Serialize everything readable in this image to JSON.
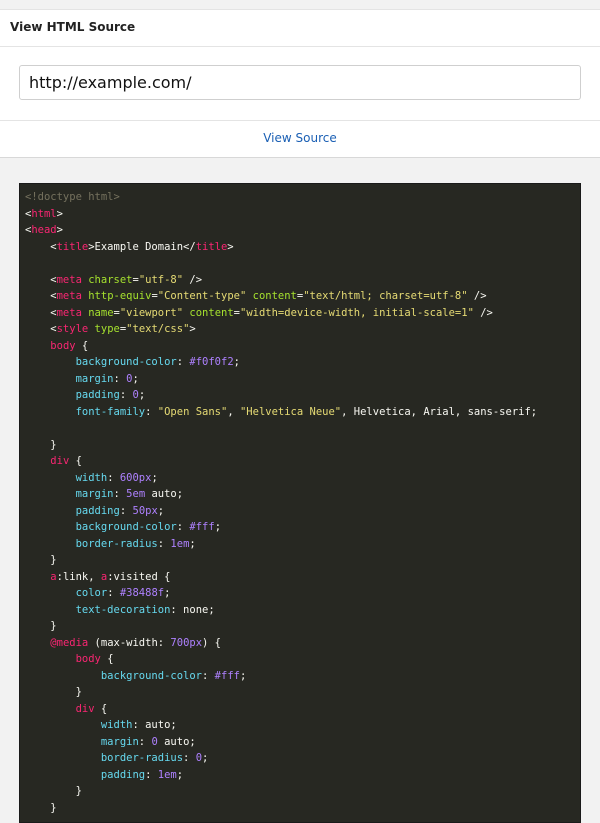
{
  "header": {
    "title": "View HTML Source"
  },
  "url_input": {
    "value": "http://example.com/"
  },
  "actions": {
    "view_source_label": "View Source"
  },
  "colors": {
    "code_bg": "#272822",
    "comment": "#75715e",
    "tag": "#f92672",
    "attr": "#a6e22e",
    "string": "#e6db74",
    "property": "#66d9ef",
    "number": "#ae81ff",
    "text": "#f8f8f2",
    "link": "#1a5fb4"
  },
  "code": [
    [
      [
        "c",
        "<!doctype html>"
      ]
    ],
    [
      [
        "p",
        "<"
      ],
      [
        "t",
        "html"
      ],
      [
        "p",
        ">"
      ]
    ],
    [
      [
        "p",
        "<"
      ],
      [
        "t",
        "head"
      ],
      [
        "p",
        ">"
      ]
    ],
    [
      [
        "p",
        "    <"
      ],
      [
        "t",
        "title"
      ],
      [
        "p",
        ">Example Domain</"
      ],
      [
        "t",
        "title"
      ],
      [
        "p",
        ">"
      ]
    ],
    [
      [
        "p",
        ""
      ]
    ],
    [
      [
        "p",
        "    <"
      ],
      [
        "t",
        "meta"
      ],
      [
        "p",
        " "
      ],
      [
        "a",
        "charset"
      ],
      [
        "p",
        "="
      ],
      [
        "s",
        "\"utf-8\""
      ],
      [
        "p",
        " />"
      ]
    ],
    [
      [
        "p",
        "    <"
      ],
      [
        "t",
        "meta"
      ],
      [
        "p",
        " "
      ],
      [
        "a",
        "http-equiv"
      ],
      [
        "p",
        "="
      ],
      [
        "s",
        "\"Content-type\""
      ],
      [
        "p",
        " "
      ],
      [
        "a",
        "content"
      ],
      [
        "p",
        "="
      ],
      [
        "s",
        "\"text/html; charset=utf-8\""
      ],
      [
        "p",
        " />"
      ]
    ],
    [
      [
        "p",
        "    <"
      ],
      [
        "t",
        "meta"
      ],
      [
        "p",
        " "
      ],
      [
        "a",
        "name"
      ],
      [
        "p",
        "="
      ],
      [
        "s",
        "\"viewport\""
      ],
      [
        "p",
        " "
      ],
      [
        "a",
        "content"
      ],
      [
        "p",
        "="
      ],
      [
        "s",
        "\"width=device-width, initial-scale=1\""
      ],
      [
        "p",
        " />"
      ]
    ],
    [
      [
        "p",
        "    <"
      ],
      [
        "t",
        "style"
      ],
      [
        "p",
        " "
      ],
      [
        "a",
        "type"
      ],
      [
        "p",
        "="
      ],
      [
        "s",
        "\"text/css\""
      ],
      [
        "p",
        ">"
      ]
    ],
    [
      [
        "p",
        "    "
      ],
      [
        "t",
        "body"
      ],
      [
        "p",
        " {"
      ]
    ],
    [
      [
        "p",
        "        "
      ],
      [
        "k",
        "background-color"
      ],
      [
        "p",
        ": "
      ],
      [
        "n",
        "#f0f0f2"
      ],
      [
        "p",
        ";"
      ]
    ],
    [
      [
        "p",
        "        "
      ],
      [
        "k",
        "margin"
      ],
      [
        "p",
        ": "
      ],
      [
        "n",
        "0"
      ],
      [
        "p",
        ";"
      ]
    ],
    [
      [
        "p",
        "        "
      ],
      [
        "k",
        "padding"
      ],
      [
        "p",
        ": "
      ],
      [
        "n",
        "0"
      ],
      [
        "p",
        ";"
      ]
    ],
    [
      [
        "p",
        "        "
      ],
      [
        "k",
        "font-family"
      ],
      [
        "p",
        ": "
      ],
      [
        "s",
        "\"Open Sans\""
      ],
      [
        "p",
        ", "
      ],
      [
        "s",
        "\"Helvetica Neue\""
      ],
      [
        "p",
        ", Helvetica, Arial, sans-serif;"
      ]
    ],
    [
      [
        "p",
        ""
      ]
    ],
    [
      [
        "p",
        "    }"
      ]
    ],
    [
      [
        "p",
        "    "
      ],
      [
        "t",
        "div"
      ],
      [
        "p",
        " {"
      ]
    ],
    [
      [
        "p",
        "        "
      ],
      [
        "k",
        "width"
      ],
      [
        "p",
        ": "
      ],
      [
        "n",
        "600px"
      ],
      [
        "p",
        ";"
      ]
    ],
    [
      [
        "p",
        "        "
      ],
      [
        "k",
        "margin"
      ],
      [
        "p",
        ": "
      ],
      [
        "n",
        "5em"
      ],
      [
        "p",
        " auto;"
      ]
    ],
    [
      [
        "p",
        "        "
      ],
      [
        "k",
        "padding"
      ],
      [
        "p",
        ": "
      ],
      [
        "n",
        "50px"
      ],
      [
        "p",
        ";"
      ]
    ],
    [
      [
        "p",
        "        "
      ],
      [
        "k",
        "background-color"
      ],
      [
        "p",
        ": "
      ],
      [
        "n",
        "#fff"
      ],
      [
        "p",
        ";"
      ]
    ],
    [
      [
        "p",
        "        "
      ],
      [
        "k",
        "border-radius"
      ],
      [
        "p",
        ": "
      ],
      [
        "n",
        "1em"
      ],
      [
        "p",
        ";"
      ]
    ],
    [
      [
        "p",
        "    }"
      ]
    ],
    [
      [
        "p",
        "    "
      ],
      [
        "t",
        "a"
      ],
      [
        "p",
        ":link, "
      ],
      [
        "t",
        "a"
      ],
      [
        "p",
        ":visited {"
      ]
    ],
    [
      [
        "p",
        "        "
      ],
      [
        "k",
        "color"
      ],
      [
        "p",
        ": "
      ],
      [
        "n",
        "#38488f"
      ],
      [
        "p",
        ";"
      ]
    ],
    [
      [
        "p",
        "        "
      ],
      [
        "k",
        "text-decoration"
      ],
      [
        "p",
        ": none;"
      ]
    ],
    [
      [
        "p",
        "    }"
      ]
    ],
    [
      [
        "p",
        "    "
      ],
      [
        "t",
        "@media"
      ],
      [
        "p",
        " (max-width: "
      ],
      [
        "n",
        "700px"
      ],
      [
        "p",
        ") {"
      ]
    ],
    [
      [
        "p",
        "        "
      ],
      [
        "t",
        "body"
      ],
      [
        "p",
        " {"
      ]
    ],
    [
      [
        "p",
        "            "
      ],
      [
        "k",
        "background-color"
      ],
      [
        "p",
        ": "
      ],
      [
        "n",
        "#fff"
      ],
      [
        "p",
        ";"
      ]
    ],
    [
      [
        "p",
        "        }"
      ]
    ],
    [
      [
        "p",
        "        "
      ],
      [
        "t",
        "div"
      ],
      [
        "p",
        " {"
      ]
    ],
    [
      [
        "p",
        "            "
      ],
      [
        "k",
        "width"
      ],
      [
        "p",
        ": auto;"
      ]
    ],
    [
      [
        "p",
        "            "
      ],
      [
        "k",
        "margin"
      ],
      [
        "p",
        ": "
      ],
      [
        "n",
        "0"
      ],
      [
        "p",
        " auto;"
      ]
    ],
    [
      [
        "p",
        "            "
      ],
      [
        "k",
        "border-radius"
      ],
      [
        "p",
        ": "
      ],
      [
        "n",
        "0"
      ],
      [
        "p",
        ";"
      ]
    ],
    [
      [
        "p",
        "            "
      ],
      [
        "k",
        "padding"
      ],
      [
        "p",
        ": "
      ],
      [
        "n",
        "1em"
      ],
      [
        "p",
        ";"
      ]
    ],
    [
      [
        "p",
        "        }"
      ]
    ],
    [
      [
        "p",
        "    }"
      ]
    ]
  ]
}
